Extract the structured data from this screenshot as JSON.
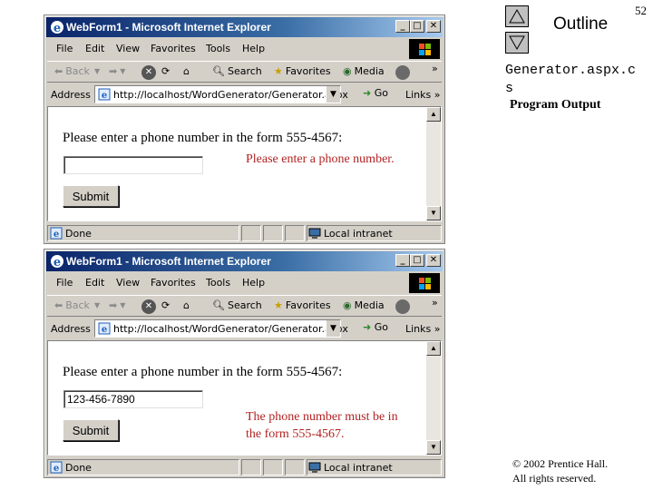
{
  "windows": [
    {
      "title": "WebForm1 - Microsoft Internet Explorer",
      "caption_buttons": {
        "minimize": "_",
        "maximize": "□",
        "close": "✕"
      },
      "menu": [
        "File",
        "Edit",
        "View",
        "Favorites",
        "Tools",
        "Help"
      ],
      "toolbar": {
        "back": "Back",
        "search": "Search",
        "favorites": "Favorites",
        "media": "Media",
        "chevron": "»"
      },
      "address": {
        "label": "Address",
        "url": "http://localhost/WordGenerator/Generator.aspx",
        "go": "Go",
        "links": "Links"
      },
      "page": {
        "prompt": "Please enter a phone number in the form 555-4567:",
        "input_value": "",
        "error_lines": [
          "Please enter a phone number."
        ],
        "submit": "Submit"
      },
      "status": {
        "text": "Done",
        "zone": "Local intranet"
      }
    },
    {
      "title": "WebForm1 - Microsoft Internet Explorer",
      "caption_buttons": {
        "minimize": "_",
        "maximize": "□",
        "close": "✕"
      },
      "menu": [
        "File",
        "Edit",
        "View",
        "Favorites",
        "Tools",
        "Help"
      ],
      "toolbar": {
        "back": "Back",
        "search": "Search",
        "favorites": "Favorites",
        "media": "Media",
        "chevron": "»"
      },
      "address": {
        "label": "Address",
        "url": "http://localhost/WordGenerator/Generator.aspx",
        "go": "Go",
        "links": "Links"
      },
      "page": {
        "prompt": "Please enter a phone number in the form 555-4567:",
        "input_value": "123-456-7890",
        "error_lines": [
          "The phone number must be in",
          "the form 555-4567."
        ],
        "submit": "Submit"
      },
      "status": {
        "text": "Done",
        "zone": "Local intranet"
      }
    }
  ],
  "slide": {
    "outline_label": "Outline",
    "page_number": "52",
    "filename_lines": [
      "Generator.aspx.c",
      "s"
    ],
    "caption": "Program Output",
    "copyright_lines": [
      "© 2002 Prentice Hall.",
      "All rights reserved."
    ]
  },
  "colors": {
    "titlebar_start": "#0a246a",
    "titlebar_end": "#a6caf0",
    "chrome": "#d4d0c8",
    "error_text": "#b22222"
  }
}
